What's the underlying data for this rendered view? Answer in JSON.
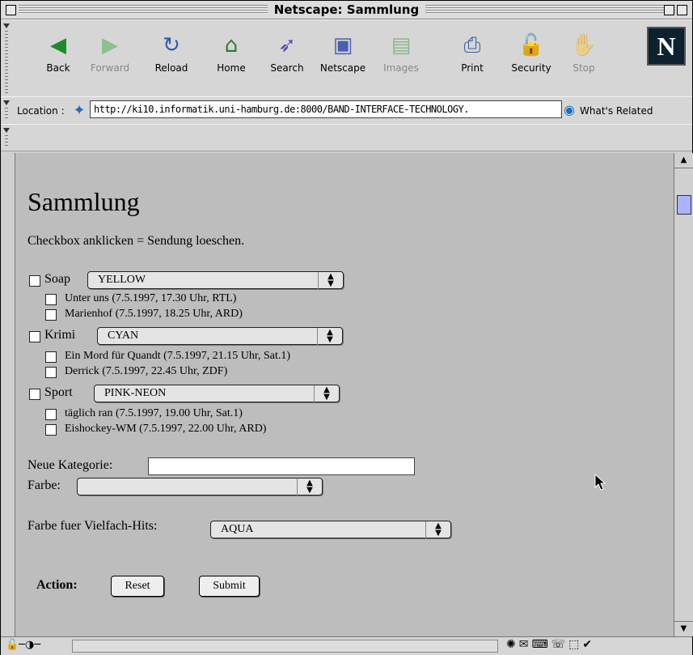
{
  "window": {
    "title": "Netscape: Sammlung"
  },
  "toolbar": {
    "buttons": [
      {
        "label": "Back",
        "icon": "back-arrow-icon",
        "glyph": "◀",
        "color": "#1f8a2a",
        "enabled": true
      },
      {
        "label": "Forward",
        "icon": "forward-arrow-icon",
        "glyph": "▶",
        "color": "#2aa83a",
        "enabled": false
      },
      {
        "label": "Reload",
        "icon": "reload-icon",
        "glyph": "↻",
        "color": "#2b5fa8",
        "enabled": true
      },
      {
        "label": "Home",
        "icon": "home-icon",
        "glyph": "⌂",
        "color": "#2d7a2d",
        "enabled": true
      },
      {
        "label": "Search",
        "icon": "search-icon",
        "glyph": "➶",
        "color": "#5a4aa8",
        "enabled": true
      },
      {
        "label": "Netscape",
        "icon": "my-netscape-icon",
        "glyph": "▣",
        "color": "#4a5fb0",
        "enabled": true
      },
      {
        "label": "Images",
        "icon": "images-icon",
        "glyph": "▤",
        "color": "#3a8a3a",
        "enabled": false
      },
      {
        "label": "Print",
        "icon": "print-icon",
        "glyph": "⎙",
        "color": "#3560a0",
        "enabled": true
      },
      {
        "label": "Security",
        "icon": "security-lock-icon",
        "glyph": "🔓",
        "color": "#b02020",
        "enabled": true
      },
      {
        "label": "Stop",
        "icon": "stop-icon",
        "glyph": "✋",
        "color": "#a03a60",
        "enabled": false
      }
    ],
    "logo": "N"
  },
  "location": {
    "label": "Location :",
    "url": "http://ki10.informatik.uni-hamburg.de:8000/BAND-INTERFACE-TECHNOLOGY.",
    "related": "What's Related"
  },
  "page": {
    "heading": "Sammlung",
    "instruction": "Checkbox anklicken = Sendung loeschen.",
    "categories": [
      {
        "label": "Soap",
        "color": "YELLOW",
        "shows": [
          "Unter uns (7.5.1997, 17.30 Uhr, RTL)",
          "Marienhof (7.5.1997, 18.25 Uhr, ARD)"
        ]
      },
      {
        "label": "Krimi",
        "color": "CYAN",
        "shows": [
          "Ein Mord für Quandt (7.5.1997, 21.15 Uhr, Sat.1)",
          "Derrick (7.5.1997, 22.45 Uhr, ZDF)"
        ]
      },
      {
        "label": "Sport",
        "color": "PINK-NEON",
        "shows": [
          "täglich ran (7.5.1997, 19.00 Uhr, Sat.1)",
          "Eishockey-WM (7.5.1997, 22.00 Uhr, ARD)"
        ]
      }
    ],
    "new_category_label": "Neue Kategorie:",
    "new_category_value": "",
    "color_label": "Farbe:",
    "color_value": "",
    "multi_hit_label": "Farbe fuer Vielfach-Hits:",
    "multi_hit_value": "AQUA",
    "action_label": "Action:",
    "reset_label": "Reset",
    "submit_label": "Submit"
  }
}
